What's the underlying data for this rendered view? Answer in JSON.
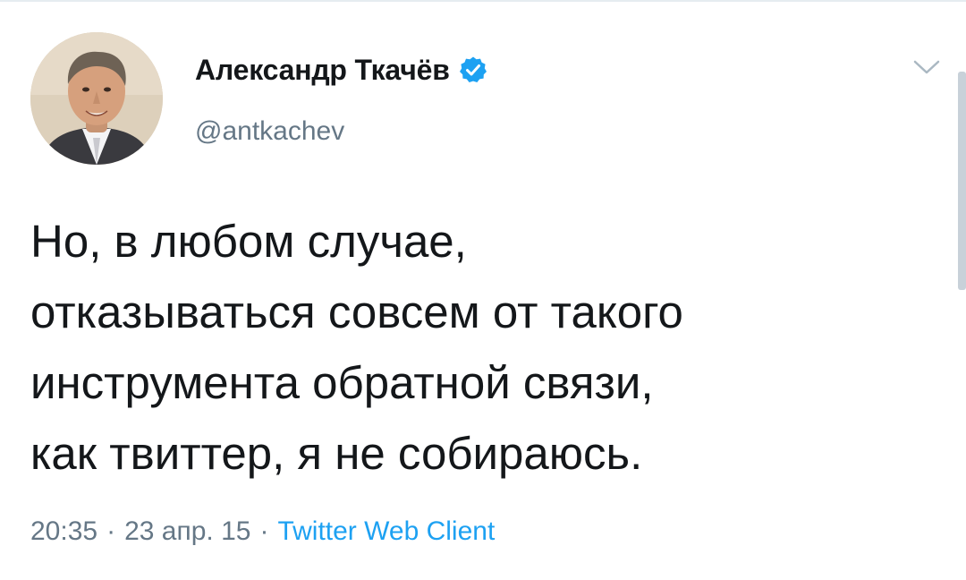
{
  "author": {
    "display_name": "Александр Ткачёв",
    "handle": "@antkachev",
    "verified": true,
    "avatar_icon": "avatar-photo"
  },
  "tweet": {
    "lines": [
      "Но, в любом случае,",
      "отказываться совсем от такого",
      "инструмента обратной связи,",
      "как твиттер, я не собираюсь."
    ]
  },
  "meta": {
    "time": "20:35",
    "separator": "·",
    "date": "23 апр. 15",
    "source": "Twitter Web Client"
  },
  "icons": {
    "verified": "verified-badge-icon",
    "menu": "chevron-down-icon"
  },
  "colors": {
    "text": "#14171a",
    "secondary": "#657786",
    "accent": "#1da1f2"
  }
}
